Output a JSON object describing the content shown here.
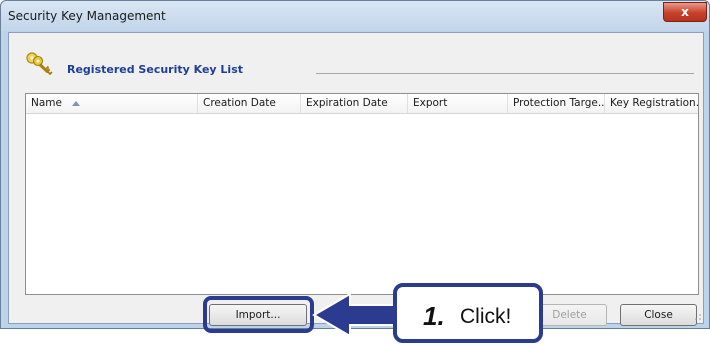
{
  "window": {
    "title": "Security Key Management",
    "close_glyph": "x"
  },
  "section": {
    "title": "Registered Security Key List",
    "icon": "keys-icon"
  },
  "list": {
    "columns": [
      {
        "label": "Name",
        "sorted": "ascending"
      },
      {
        "label": "Creation Date"
      },
      {
        "label": "Expiration Date"
      },
      {
        "label": "Export"
      },
      {
        "label": "Protection Targe..."
      },
      {
        "label": "Key Registration..."
      }
    ],
    "rows": []
  },
  "buttons": {
    "import": "Import...",
    "delete": "Delete",
    "close": "Close"
  },
  "annotation": {
    "step": "1.",
    "text": "Click!",
    "color": "#2b3b8f"
  }
}
